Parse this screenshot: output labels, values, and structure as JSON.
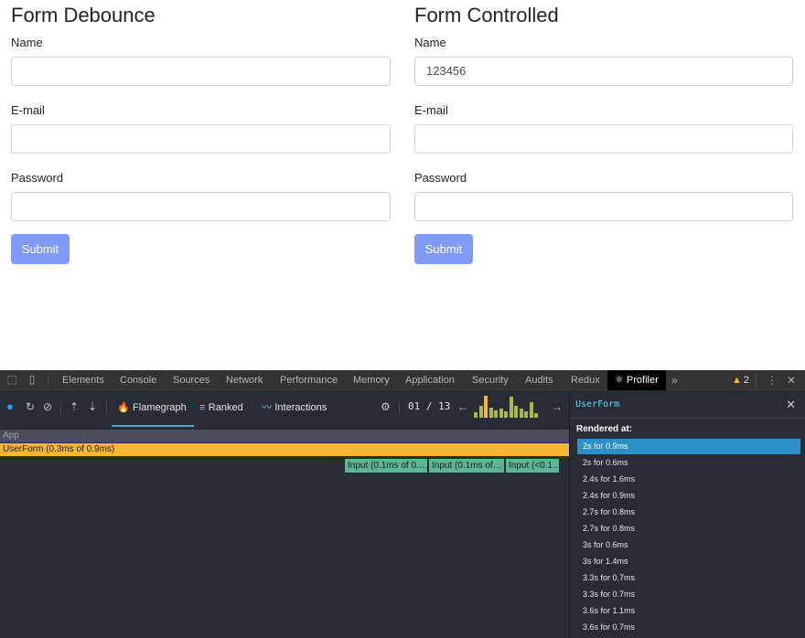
{
  "forms": {
    "debounce": {
      "title": "Form Debounce",
      "name_label": "Name",
      "name_value": "",
      "email_label": "E-mail",
      "email_value": "",
      "password_label": "Password",
      "password_value": "",
      "submit_label": "Submit"
    },
    "controlled": {
      "title": "Form Controlled",
      "name_label": "Name",
      "name_value": "123456",
      "email_label": "E-mail",
      "email_value": "",
      "password_label": "Password",
      "password_value": "",
      "submit_label": "Submit"
    }
  },
  "devtools": {
    "tabs": [
      "Elements",
      "Console",
      "Sources",
      "Network",
      "Performance",
      "Memory",
      "Application",
      "Security",
      "Audits",
      "Redux"
    ],
    "active_tab": "Profiler",
    "warning_count": "2",
    "toolbar": {
      "flamegraph_label": "Flamegraph",
      "ranked_label": "Ranked",
      "interactions_label": "Interactions",
      "commit_counter": "01 / 13",
      "commit_bars": [
        0.25,
        0.55,
        1.0,
        0.45,
        0.35,
        0.4,
        0.3,
        0.95,
        0.55,
        0.4,
        0.3,
        0.7,
        0.2
      ],
      "commit_colors": {
        "selected": "#f7b731",
        "other": "#a8b84e"
      }
    },
    "flamegraph": {
      "root_label": "App",
      "usr_form_label": "UserForm (0.3ms of 0.9ms)",
      "inputs": [
        "Input (0.1ms of 0.…",
        "Input (0.1ms of…",
        "Input (<0.1…"
      ]
    },
    "side_panel": {
      "component": "UserForm",
      "rendered_at_label": "Rendered at:",
      "renders": [
        "2s for 0.9ms",
        "2s for 0.6ms",
        "2.4s for 1.6ms",
        "2.4s for 0.9ms",
        "2.7s for 0.8ms",
        "2.7s for 0.8ms",
        "3s for 0.6ms",
        "3s for 1.4ms",
        "3.3s for 0.7ms",
        "3.3s for 0.7ms",
        "3.6s for 1.1ms",
        "3.6s for 0.7ms"
      ],
      "selected_index": 0
    }
  }
}
